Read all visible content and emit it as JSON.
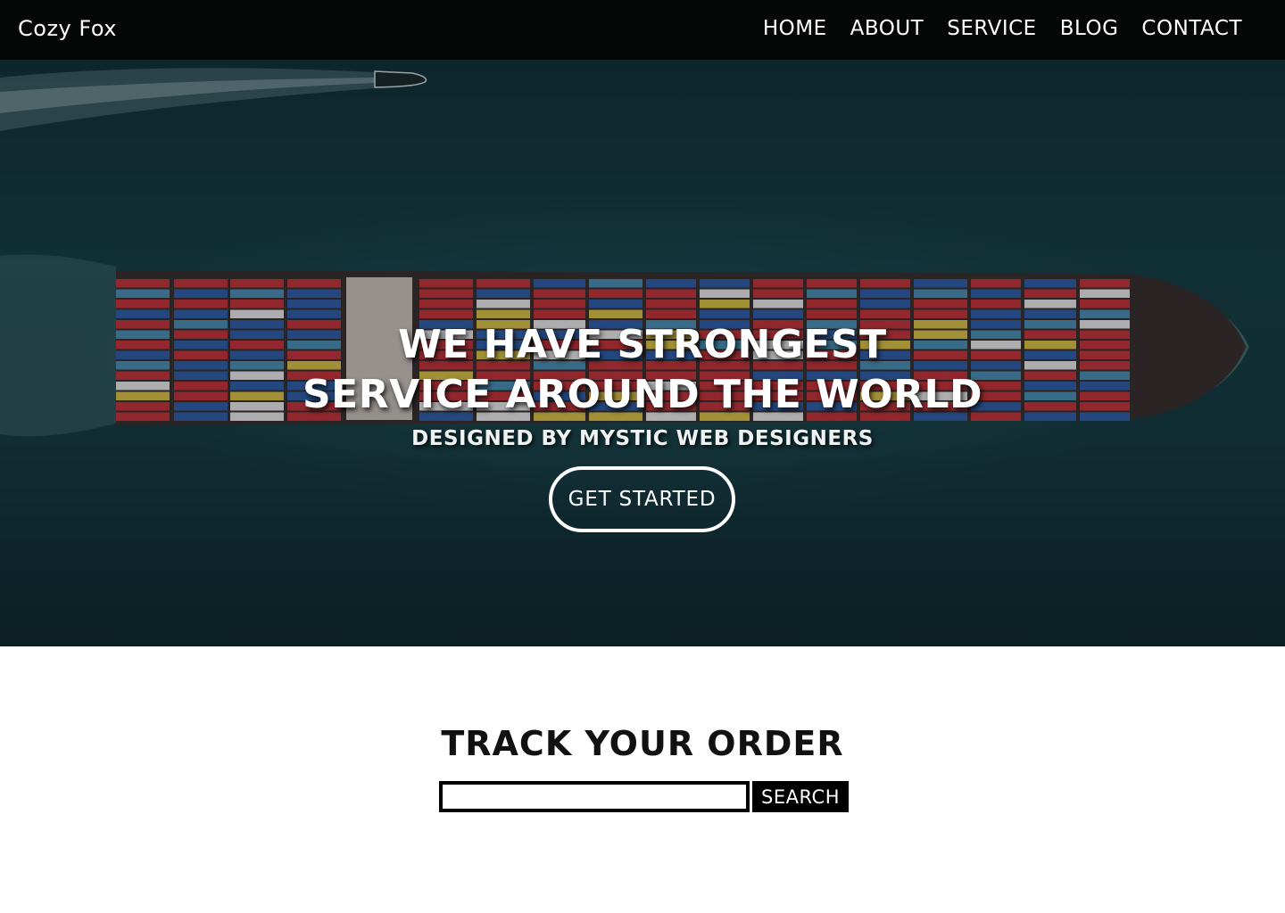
{
  "navbar": {
    "brand": "Cozy Fox",
    "links": [
      "HOME",
      "ABOUT",
      "SERVICE",
      "BLOG",
      "CONTACT"
    ]
  },
  "hero": {
    "title_line1": "WE HAVE STRONGEST",
    "title_line2": "SERVICE AROUND THE WORLD",
    "subtitle": "DESIGNED BY MYSTIC WEB DESIGNERS",
    "cta_label": "GET STARTED"
  },
  "track": {
    "title": "TRACK YOUR ORDER",
    "input_value": "",
    "search_label": "SEARCH"
  },
  "colors": {
    "navbar_bg": "#050606",
    "sea": "#174048",
    "container_red": "#c3353c",
    "container_blue": "#2f5fa8",
    "container_white": "#e7e7ea",
    "button_bg": "#000000"
  }
}
